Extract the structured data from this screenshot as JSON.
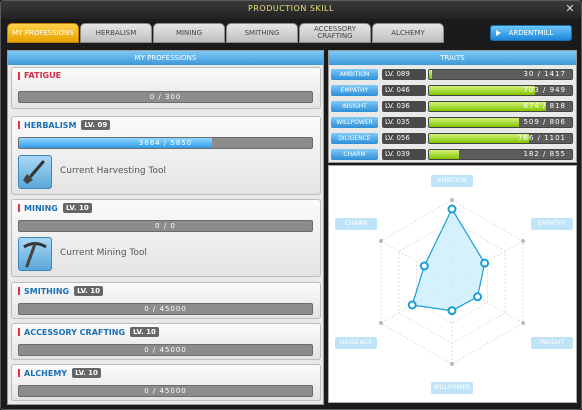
{
  "window": {
    "title": "PRODUCTION SKILL"
  },
  "tabs": [
    {
      "label": "MY PROFESSIONS",
      "active": true
    },
    {
      "label": "HERBALISM"
    },
    {
      "label": "MINING"
    },
    {
      "label": "SMITHING"
    },
    {
      "label": "ACCESSORY CRAFTING"
    },
    {
      "label": "ALCHEMY"
    }
  ],
  "ardentmill_button": "ARDENTMILL",
  "left_panel": {
    "header": "MY PROFESSIONS"
  },
  "professions": {
    "fatigue": {
      "name": "FATIGUE",
      "value": "0 / 300",
      "fraction": 0
    },
    "herbalism": {
      "name": "HERBALISM",
      "level": "LV. 09",
      "value": "3864 / 5850",
      "fraction": 0.66,
      "tool_label": "Current Harvesting Tool"
    },
    "mining": {
      "name": "MINING",
      "level": "LV. 10",
      "value": "0 / 0",
      "fraction": 0,
      "tool_label": "Current Mining Tool"
    },
    "smithing": {
      "name": "SMITHING",
      "level": "LV. 10",
      "value": "0 / 45000",
      "fraction": 0
    },
    "accessory": {
      "name": "ACCESSORY CRAFTING",
      "level": "LV. 10",
      "value": "0 / 45000",
      "fraction": 0
    },
    "alchemy": {
      "name": "ALCHEMY",
      "level": "LV. 10",
      "value": "0 / 45000",
      "fraction": 0
    }
  },
  "traits_panel": {
    "header": "TRAITS",
    "items": [
      {
        "name": "AMBITION",
        "level": "LV. 089",
        "value": "30 / 1417",
        "fraction": 0.02
      },
      {
        "name": "EMPATHY",
        "level": "LV. 046",
        "value": "703 / 949",
        "fraction": 0.74
      },
      {
        "name": "INSIGHT",
        "level": "LV. 036",
        "value": "674 / 818",
        "fraction": 0.82
      },
      {
        "name": "WILLPOWER",
        "level": "LV. 035",
        "value": "509 / 806",
        "fraction": 0.63
      },
      {
        "name": "DILIGENCE",
        "level": "LV. 056",
        "value": "766 / 1101",
        "fraction": 0.7
      },
      {
        "name": "CHARM",
        "level": "LV. 039",
        "value": "182 / 855",
        "fraction": 0.21
      }
    ]
  },
  "radar": {
    "labels": [
      "AMBITION",
      "EMPATHY",
      "INSIGHT",
      "WILLPOWER",
      "DILIGENCE",
      "CHARM"
    ],
    "values": [
      89,
      46,
      36,
      35,
      56,
      39
    ],
    "max": 100,
    "fill_color": "#c9eefb",
    "stroke_color": "#1a9ed8"
  }
}
